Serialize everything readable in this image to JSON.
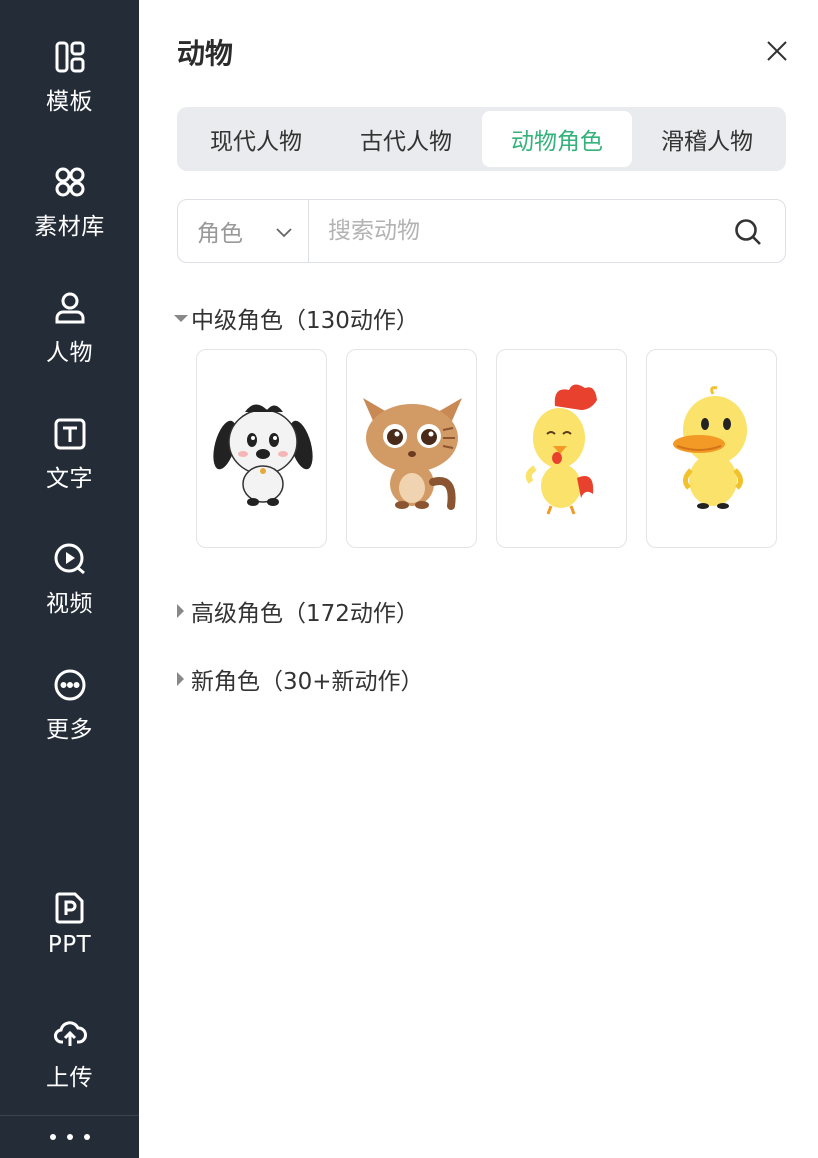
{
  "sidebar": {
    "items": [
      {
        "label": "模板",
        "icon": "template-icon"
      },
      {
        "label": "素材库",
        "icon": "material-library-icon"
      },
      {
        "label": "人物",
        "icon": "person-icon"
      },
      {
        "label": "文字",
        "icon": "text-icon"
      },
      {
        "label": "视频",
        "icon": "video-icon"
      },
      {
        "label": "更多",
        "icon": "more-icon"
      },
      {
        "label": "PPT",
        "icon": "ppt-icon"
      },
      {
        "label": "上传",
        "icon": "upload-cloud-icon"
      }
    ]
  },
  "panel": {
    "title": "动物",
    "tabs": [
      {
        "label": "现代人物",
        "active": false
      },
      {
        "label": "古代人物",
        "active": false
      },
      {
        "label": "动物角色",
        "active": true
      },
      {
        "label": "滑稽人物",
        "active": false
      }
    ],
    "search": {
      "select_value": "角色",
      "placeholder": "搜索动物",
      "value": ""
    },
    "sections": [
      {
        "title": "中级角色（130动作）",
        "expanded": true
      },
      {
        "title": "高级角色（172动作）",
        "expanded": false
      },
      {
        "title": "新角色（30+新动作）",
        "expanded": false
      }
    ],
    "characters": [
      {
        "name": "dog"
      },
      {
        "name": "cat"
      },
      {
        "name": "rooster"
      },
      {
        "name": "duck"
      }
    ]
  },
  "colors": {
    "sidebar_bg": "#242c38",
    "accent": "#35b17c",
    "tabs_bg": "#e9ebee"
  }
}
